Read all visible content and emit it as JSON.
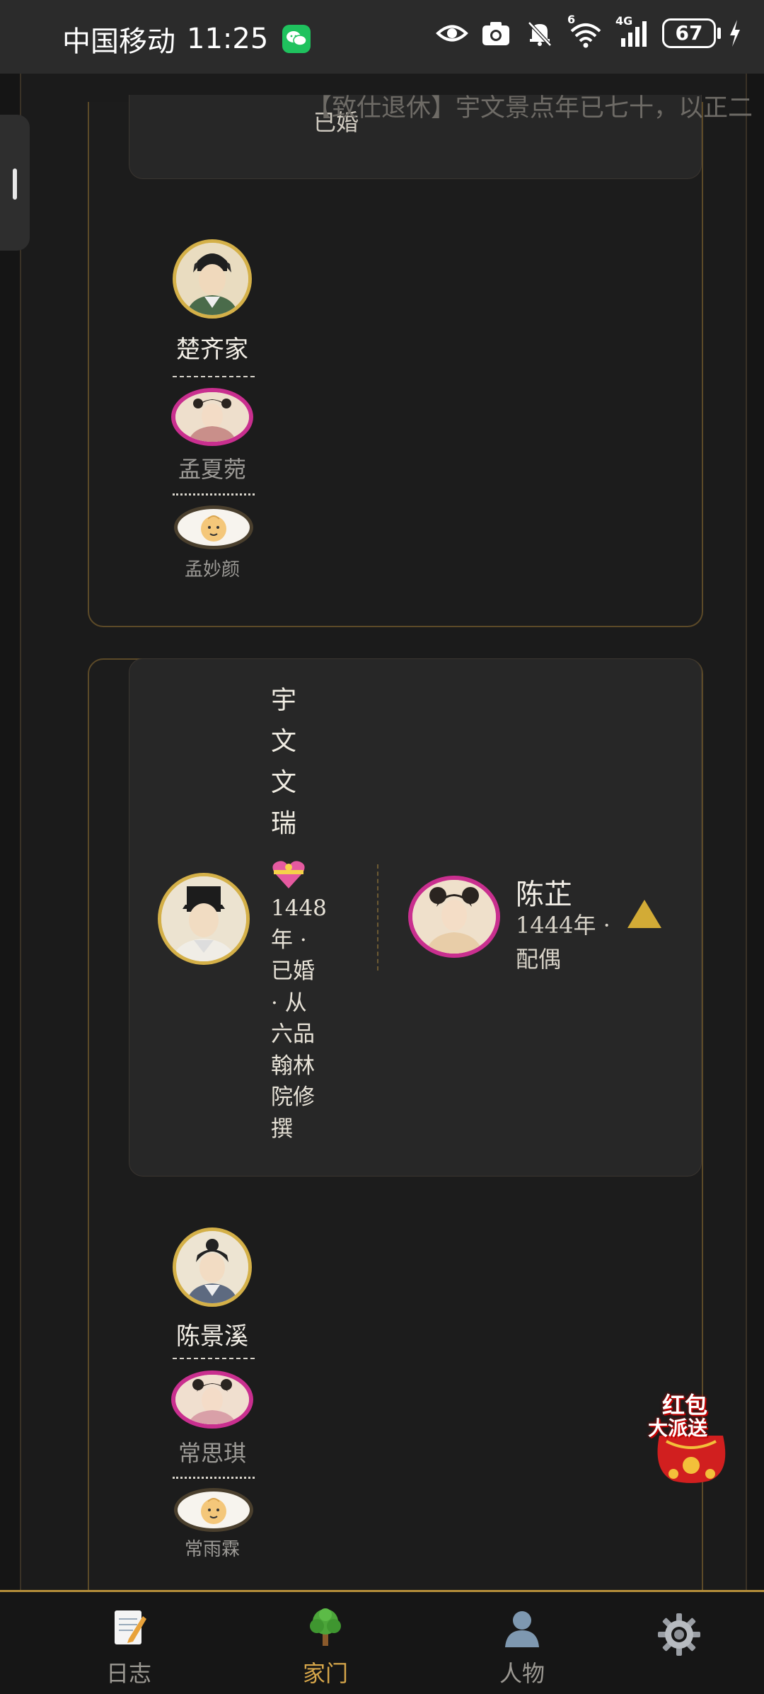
{
  "status_bar": {
    "carrier": "中国移动",
    "time": "11:25",
    "network": "4G",
    "network_sup": "6",
    "battery": "67"
  },
  "families": [
    {
      "head": {
        "meta_tail": "已婚",
        "event_log": "【致仕退休】宇文景点年已七十，以正二"
      },
      "child": {
        "name": "楚齐家",
        "spouse": "孟夏菀",
        "baby": "孟妙颜"
      }
    },
    {
      "head": {
        "name_chars": [
          "宇",
          "文",
          "文",
          "瑞"
        ],
        "meta_lines": [
          "1448",
          "年 ·",
          "已婚",
          "· 从",
          "六品",
          "翰林",
          "院修",
          "撰"
        ],
        "spouse_name": "陈芷",
        "spouse_meta_lines": [
          "1444年 ·",
          "配偶"
        ]
      },
      "child": {
        "name": "陈景溪",
        "spouse": "常思琪",
        "baby": "常雨霖"
      }
    }
  ],
  "promo": {
    "line1": "红包",
    "line2": "大派送"
  },
  "bottom_nav": [
    {
      "label": "日志",
      "icon": "memo-icon"
    },
    {
      "label": "家门",
      "icon": "tree-icon",
      "active": true
    },
    {
      "label": "人物",
      "icon": "person-icon"
    },
    {
      "label": "",
      "icon": "gear-icon"
    }
  ]
}
